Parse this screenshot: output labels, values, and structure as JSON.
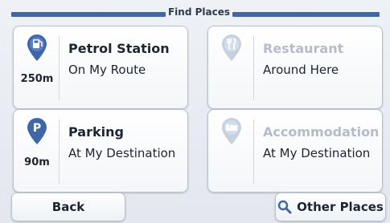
{
  "header": {
    "title": "Find Places"
  },
  "tiles": [
    {
      "title": "Petrol Station",
      "subtitle": "On My Route",
      "distance": "250m",
      "icon": "fuel-pin-icon",
      "enabled": true
    },
    {
      "title": "Restaurant",
      "subtitle": "Around Here",
      "distance": "",
      "icon": "restaurant-pin-icon",
      "enabled": false
    },
    {
      "title": "Parking",
      "subtitle": "At My Destination",
      "distance": "90m",
      "icon": "parking-pin-icon",
      "enabled": true
    },
    {
      "title": "Accommodation",
      "subtitle": "At My Destination",
      "distance": "",
      "icon": "bed-pin-icon",
      "enabled": false
    }
  ],
  "buttons": {
    "back": "Back",
    "other_places": "Other Places"
  },
  "colors": {
    "accent": "#3f67a8",
    "disabled": "#b4bcc8",
    "text": "#1c2533"
  }
}
